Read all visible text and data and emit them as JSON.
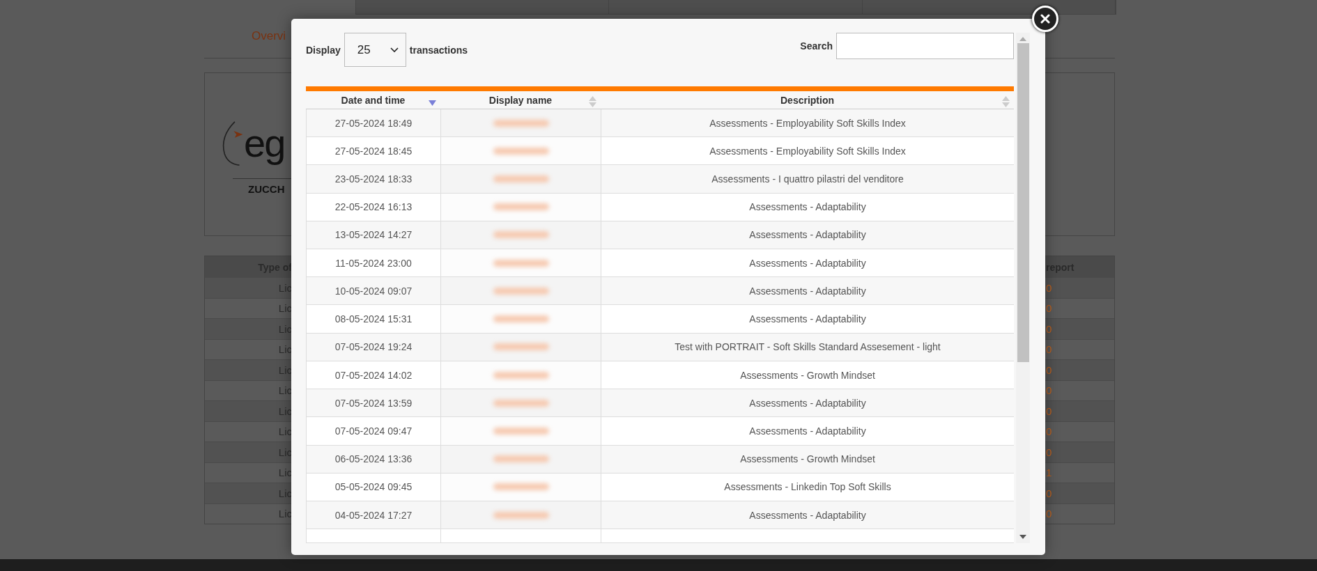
{
  "background": {
    "tab": "Overvi",
    "logo": {
      "mark": "eg",
      "subtitle": "ZUCCH"
    },
    "table": {
      "columns": [
        "Type of",
        "report"
      ],
      "rows": [
        {
          "type": "Lic",
          "report": "0"
        },
        {
          "type": "Lic",
          "report": "0"
        },
        {
          "type": "Lic",
          "report": "0"
        },
        {
          "type": "Lic",
          "report": "0"
        },
        {
          "type": "Lic",
          "report": "0"
        },
        {
          "type": "Lic",
          "report": "0"
        },
        {
          "type": "Lic",
          "report": "0"
        },
        {
          "type": "Lic",
          "report": "0"
        },
        {
          "type": "Lic",
          "report": "0"
        },
        {
          "type": "Lic",
          "report": "1"
        },
        {
          "type": "Lic",
          "report": "0"
        },
        {
          "type": "Lic",
          "report": "0"
        }
      ]
    }
  },
  "modal": {
    "display_label": "Display",
    "page_size": "25",
    "after_label": "transactions",
    "search_label": "Search",
    "table": {
      "columns": [
        {
          "label": "Date and time",
          "sorted": true
        },
        {
          "label": "Display name",
          "sorted": false
        },
        {
          "label": "Description",
          "sorted": false
        }
      ],
      "rows": [
        {
          "date": "27-05-2024 18:49",
          "description": "Assessments - Employability Soft Skills Index"
        },
        {
          "date": "27-05-2024 18:45",
          "description": "Assessments - Employability Soft Skills Index"
        },
        {
          "date": "23-05-2024 18:33",
          "description": "Assessments - I quattro pilastri del venditore"
        },
        {
          "date": "22-05-2024 16:13",
          "description": "Assessments - Adaptability"
        },
        {
          "date": "13-05-2024 14:27",
          "description": "Assessments - Adaptability"
        },
        {
          "date": "11-05-2024 23:00",
          "description": "Assessments - Adaptability"
        },
        {
          "date": "10-05-2024 09:07",
          "description": "Assessments - Adaptability"
        },
        {
          "date": "08-05-2024 15:31",
          "description": "Assessments - Adaptability"
        },
        {
          "date": "07-05-2024 19:24",
          "description": "Test with PORTRAIT - Soft Skills Standard Assesement - light"
        },
        {
          "date": "07-05-2024 14:02",
          "description": "Assessments - Growth Mindset"
        },
        {
          "date": "07-05-2024 13:59",
          "description": "Assessments - Adaptability"
        },
        {
          "date": "07-05-2024 09:47",
          "description": "Assessments - Adaptability"
        },
        {
          "date": "06-05-2024 13:36",
          "description": "Assessments - Growth Mindset"
        },
        {
          "date": "05-05-2024 09:45",
          "description": "Assessments - Linkedin Top Soft Skills"
        },
        {
          "date": "04-05-2024 17:27",
          "description": "Assessments - Adaptability"
        }
      ]
    }
  }
}
